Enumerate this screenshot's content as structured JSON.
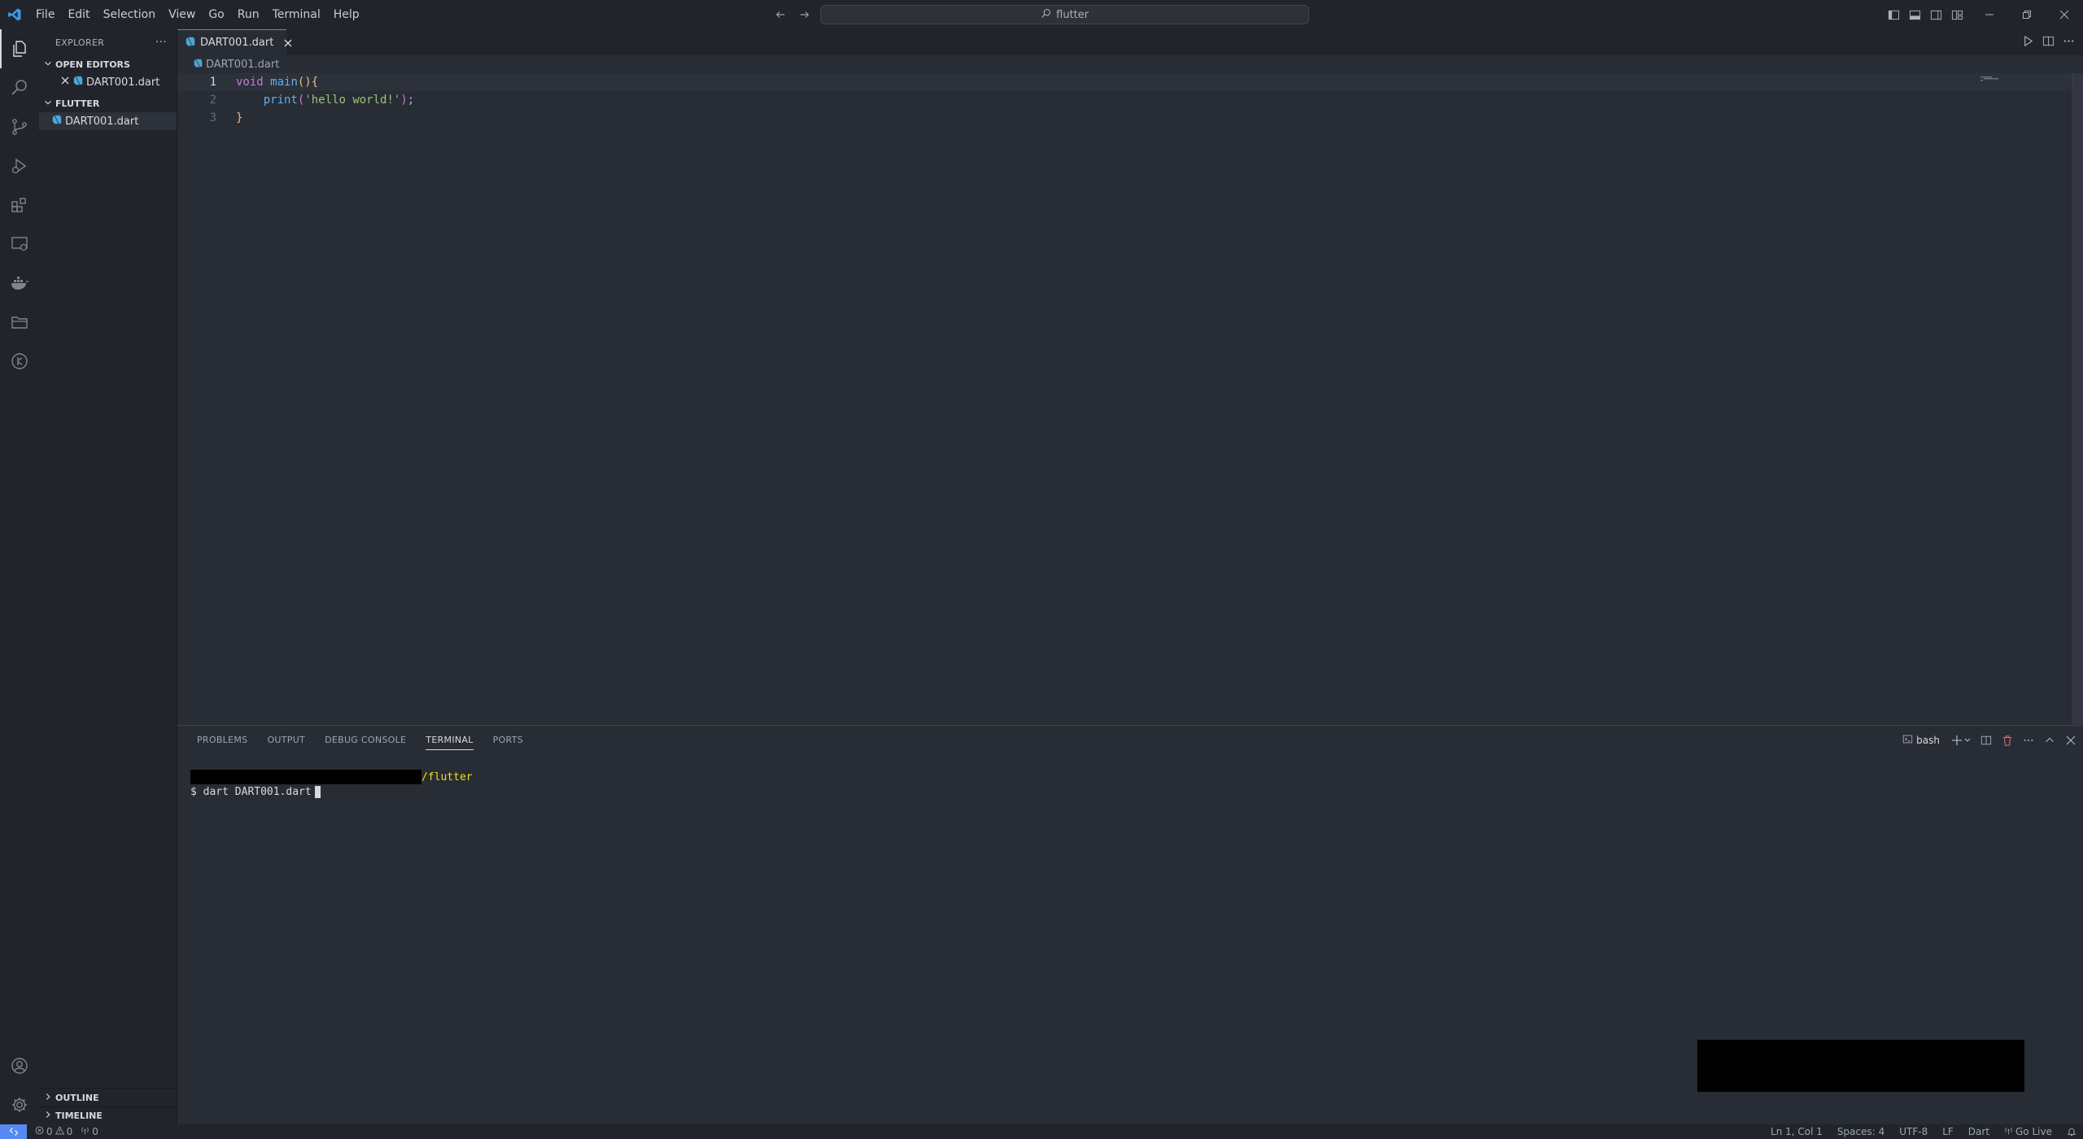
{
  "menu": [
    "File",
    "Edit",
    "Selection",
    "View",
    "Go",
    "Run",
    "Terminal",
    "Help"
  ],
  "command_center": {
    "text": "flutter"
  },
  "sidebar": {
    "title": "EXPLORER",
    "more": "···",
    "open_editors": {
      "label": "OPEN EDITORS",
      "items": [
        "DART001.dart"
      ]
    },
    "folder": {
      "label": "FLUTTER",
      "items": [
        "DART001.dart"
      ]
    },
    "outline": "OUTLINE",
    "timeline": "TIMELINE"
  },
  "editor": {
    "tab": "DART001.dart",
    "breadcrumb": "DART001.dart",
    "lines": [
      {
        "num": "1",
        "parts": [
          [
            "kw",
            "void "
          ],
          [
            "fn",
            "main"
          ],
          [
            "br1",
            "()"
          ],
          [
            "br1",
            "{"
          ]
        ]
      },
      {
        "num": "2",
        "parts": [
          [
            "pn",
            "    "
          ],
          [
            "fn",
            "print"
          ],
          [
            "br2",
            "("
          ],
          [
            "str",
            "'hello world!'"
          ],
          [
            "br2",
            ")"
          ],
          [
            "pn",
            ";"
          ]
        ]
      },
      {
        "num": "3",
        "parts": [
          [
            "br1",
            "}"
          ]
        ]
      }
    ]
  },
  "panel": {
    "tabs": [
      "PROBLEMS",
      "OUTPUT",
      "DEBUG CONSOLE",
      "TERMINAL",
      "PORTS"
    ],
    "active_tab": "TERMINAL",
    "terminal_profile": "bash",
    "terminal": {
      "path_suffix": "/flutter",
      "prompt": "$ ",
      "command": "dart DART001.dart"
    }
  },
  "statusbar": {
    "errors": "0",
    "warnings": "0",
    "ports": "0",
    "position": "Ln 1, Col 1",
    "spaces": "Spaces: 4",
    "encoding": "UTF-8",
    "eol": "LF",
    "language": "Dart",
    "golive": "Go Live"
  },
  "colors": {
    "accent": "#568af2",
    "background": "#282c34",
    "sidebar": "#21252b",
    "dart_icon": "#4fa4d8"
  }
}
